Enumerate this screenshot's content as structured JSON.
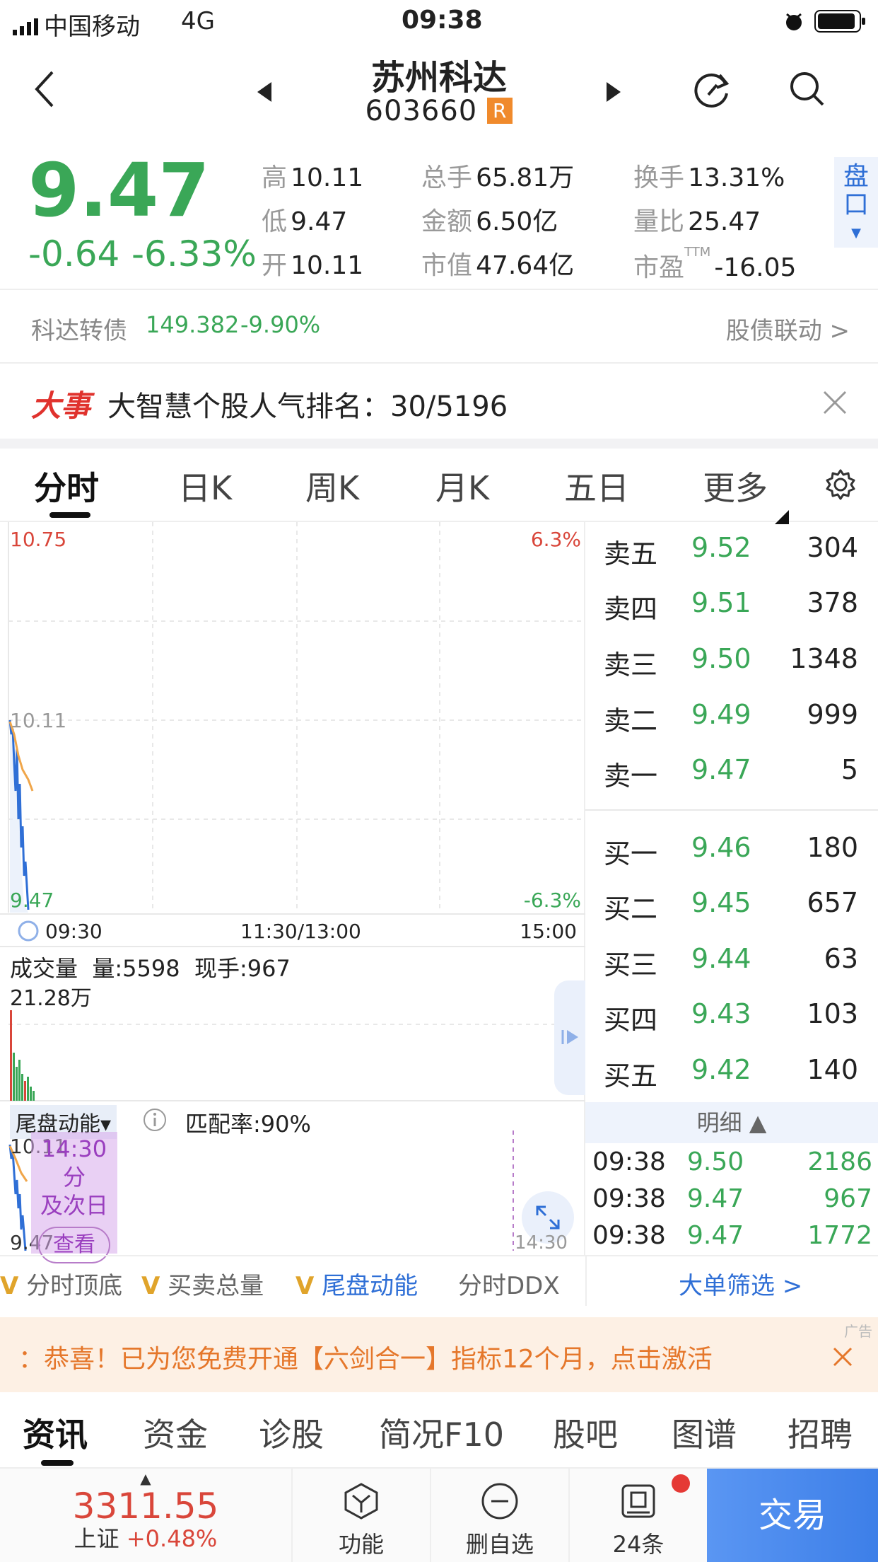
{
  "status_bar": {
    "carrier": "中国移动",
    "network": "4G",
    "time": "09:38"
  },
  "header": {
    "name": "苏州科达",
    "code": "603660",
    "badge": "R"
  },
  "quote": {
    "price": "9.47",
    "change": "-0.64",
    "change_pct": "-6.33%",
    "stats": [
      {
        "label": "高",
        "value": "10.11"
      },
      {
        "label": "总手",
        "value": "65.81万"
      },
      {
        "label": "换手",
        "value": "13.31%"
      },
      {
        "label": "低",
        "value": "9.47"
      },
      {
        "label": "金额",
        "value": "6.50亿"
      },
      {
        "label": "量比",
        "value": "25.47"
      },
      {
        "label": "开",
        "value": "10.11"
      },
      {
        "label": "市值",
        "value": "47.64亿"
      },
      {
        "label": "市盈",
        "value": "-16.05",
        "sup": "TTM"
      }
    ],
    "pankou_label": "盘口"
  },
  "bond": {
    "name": "科达转债",
    "price": "149.382",
    "change": "-9.90%",
    "link": "股债联动 >"
  },
  "event": {
    "tag": "大事",
    "text": "大智慧个股人气排名：30/5196"
  },
  "chart_tabs": [
    "分时",
    "日K",
    "周K",
    "月K",
    "五日",
    "更多"
  ],
  "chart": {
    "y_top": "10.75",
    "y_mid": "10.11",
    "y_bot": "9.47",
    "pct_top": "6.3%",
    "pct_bot": "-6.3%",
    "x_labels": [
      "09:30",
      "11:30/13:00",
      "15:00"
    ],
    "volume_label": "成交量",
    "volume_text": "量:5598",
    "hand_text": "现手:967",
    "volume_max": "21.28万",
    "indicator_name": "尾盘动能▾",
    "match_rate": "匹配率:90%",
    "ind_y_top": "10.11",
    "ind_y_bot": "9.47",
    "promo_line1": "14:30分",
    "promo_line2": "及次日",
    "promo_button": "查看",
    "ind_time": "14:30"
  },
  "order_book": {
    "asks": [
      {
        "name": "卖五",
        "price": "9.52",
        "vol": "304"
      },
      {
        "name": "卖四",
        "price": "9.51",
        "vol": "378"
      },
      {
        "name": "卖三",
        "price": "9.50",
        "vol": "1348"
      },
      {
        "name": "卖二",
        "price": "9.49",
        "vol": "999"
      },
      {
        "name": "卖一",
        "price": "9.47",
        "vol": "5"
      }
    ],
    "bids": [
      {
        "name": "买一",
        "price": "9.46",
        "vol": "180"
      },
      {
        "name": "买二",
        "price": "9.45",
        "vol": "657"
      },
      {
        "name": "买三",
        "price": "9.44",
        "vol": "63"
      },
      {
        "name": "买四",
        "price": "9.43",
        "vol": "103"
      },
      {
        "name": "买五",
        "price": "9.42",
        "vol": "140"
      }
    ],
    "detail_label": "明细 ▲",
    "details": [
      {
        "time": "09:38",
        "price": "9.50",
        "vol": "2186"
      },
      {
        "time": "09:38",
        "price": "9.47",
        "vol": "967"
      },
      {
        "time": "09:38",
        "price": "9.47",
        "vol": "1772"
      }
    ],
    "big_order_link": "大单筛选 >"
  },
  "indicator_tabs": [
    "分时顶底",
    "买卖总量",
    "尾盘动能",
    "分时DDX"
  ],
  "ad": {
    "text": "：恭喜！已为您免费开通【六剑合一】指标12个月，点击激活",
    "tag": "广告"
  },
  "bottom_tabs": [
    "资讯",
    "资金",
    "诊股",
    "简况F10",
    "股吧",
    "图谱",
    "招聘"
  ],
  "footer": {
    "index_value": "3311.55",
    "index_name": "上证",
    "index_change": "+0.48%",
    "func_label": "功能",
    "remove_label": "删自选",
    "msg_label": "24条",
    "trade_label": "交易"
  },
  "colors": {
    "up": "#d9463a",
    "down": "#3aa757",
    "link": "#2f6fd6",
    "trade_bg": "#4f8ff0"
  }
}
